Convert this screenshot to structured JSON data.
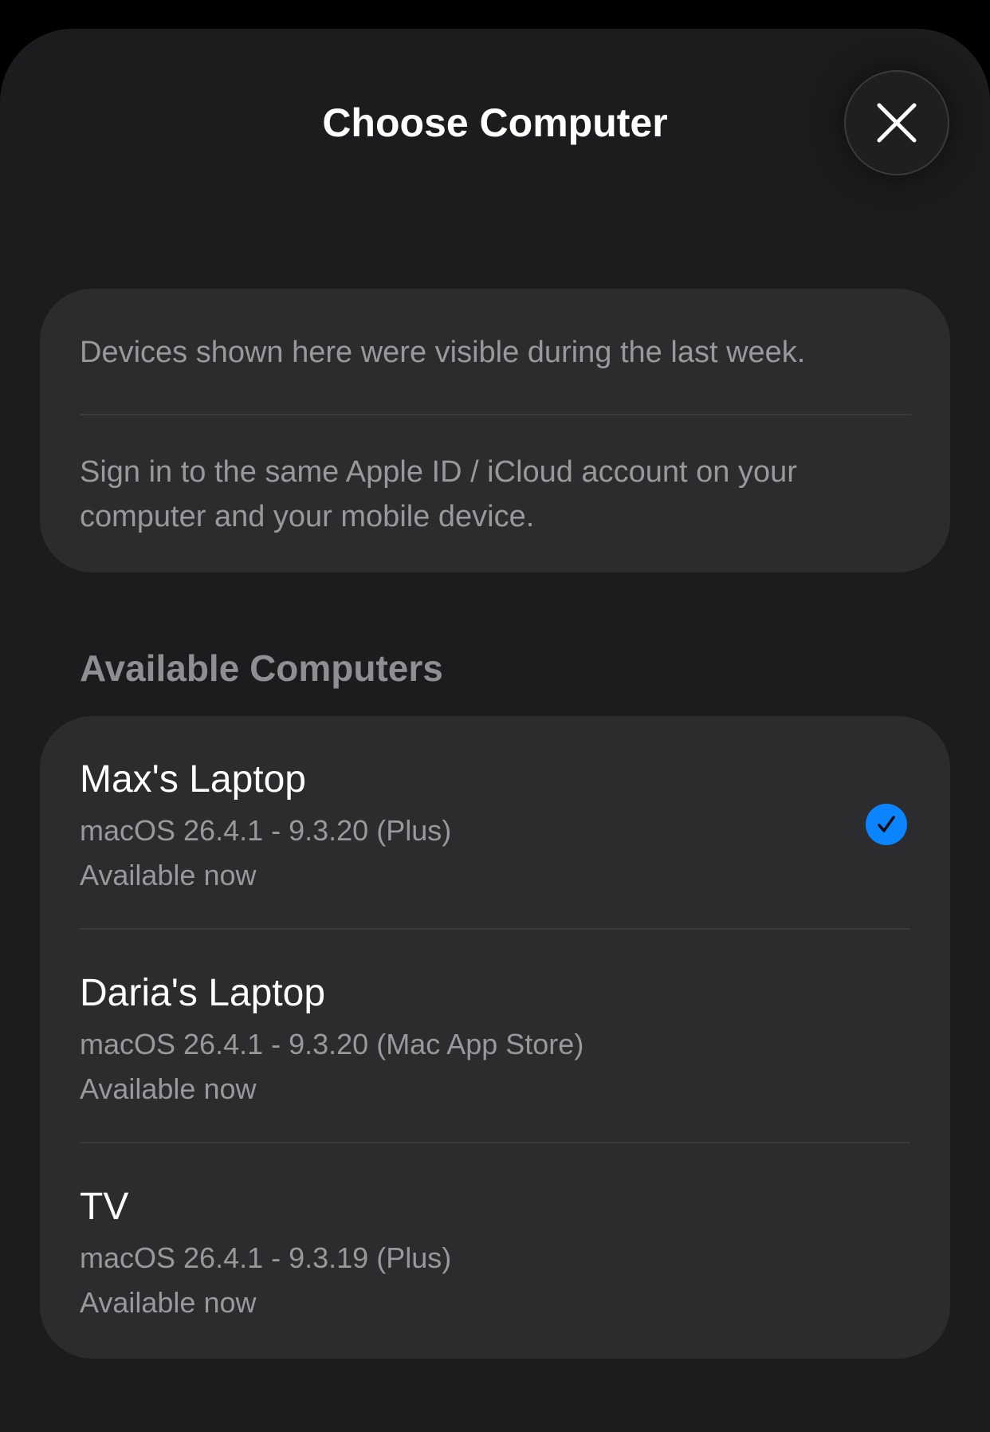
{
  "header": {
    "title": "Choose Computer"
  },
  "info": {
    "line1": "Devices shown here were visible during the last week.",
    "line2": "Sign in to the same Apple ID / iCloud account on your computer and your mobile device."
  },
  "section": {
    "title": "Available Computers"
  },
  "computers": [
    {
      "name": "Max's Laptop",
      "detail": "macOS 26.4.1 - 9.3.20 (Plus)",
      "status": "Available now",
      "selected": true
    },
    {
      "name": "Daria's Laptop",
      "detail": "macOS 26.4.1 - 9.3.20 (Mac App Store)",
      "status": "Available now",
      "selected": false
    },
    {
      "name": "TV",
      "detail": "macOS 26.4.1 - 9.3.19 (Plus)",
      "status": "Available now",
      "selected": false
    }
  ],
  "colors": {
    "background": "#1c1c1e",
    "card": "#2c2c2e",
    "accent": "#0a84ff",
    "secondary_text": "#98989d"
  },
  "icons": {
    "close": "close-icon",
    "selected": "checkmark-circle-icon"
  }
}
